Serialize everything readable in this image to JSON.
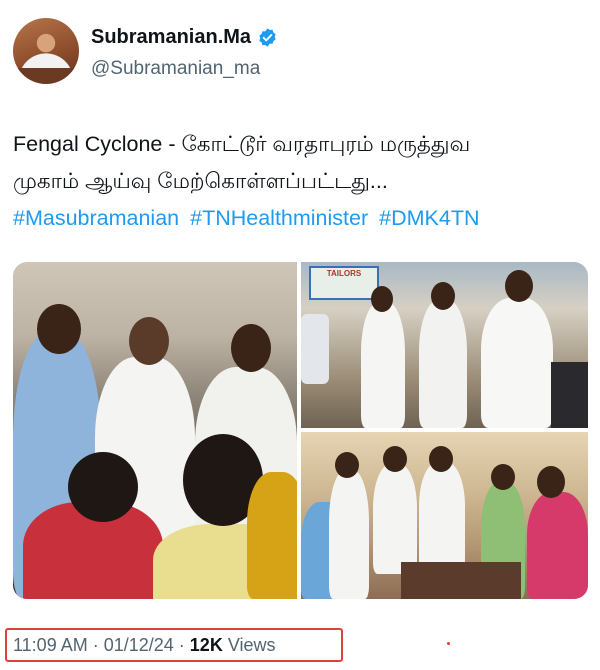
{
  "author": {
    "display_name": "Subramanian.Ma",
    "handle": "@Subramanian_ma",
    "verified": true,
    "avatar_icon": "profile-photo"
  },
  "tweet": {
    "text_line1": "Fengal Cyclone -   கோட்டூர் வரதாபுரம் மருத்துவ",
    "text_line2": "முகாம் ஆய்வு மேற்கொள்ளப்பட்டது...",
    "hashtags": [
      "#Masubramanian",
      "#TNHealthminister",
      "#DMK4TN"
    ]
  },
  "media": {
    "shop_sign": "TAILORS"
  },
  "meta": {
    "time": "11:09 AM",
    "separator": "·",
    "date": "01/12/24",
    "views_count": "12K",
    "views_label": "Views"
  },
  "colors": {
    "link": "#1d9bf0",
    "verified_badge": "#1d9bf0",
    "highlight_box": "#e0413b",
    "secondary_text": "#536471"
  }
}
